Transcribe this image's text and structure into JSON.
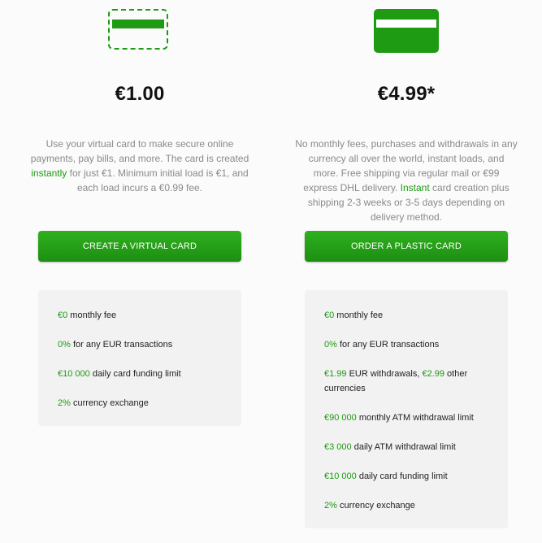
{
  "virtual": {
    "price": "€1.00",
    "desc_before": "Use your virtual card to make secure online payments, pay bills, and more. The card is created ",
    "desc_highlight": "instantly",
    "desc_after": " for just €1. Minimum initial load is €1, and each load incurs a €0.99 fee.",
    "button_label": "CREATE A VIRTUAL CARD",
    "features": [
      {
        "value": "€0",
        "text": " monthly fee"
      },
      {
        "value": "0%",
        "text": " for any EUR transactions"
      },
      {
        "value": "€10 000",
        "text": " daily card funding limit"
      },
      {
        "value": "2%",
        "text": " currency exchange"
      }
    ]
  },
  "plastic": {
    "price": "€4.99*",
    "desc_before": "No monthly fees, purchases and withdrawals in any currency all over the world, instant loads, and more. Free shipping via regular mail or €99 express DHL delivery. ",
    "desc_highlight": "Instant",
    "desc_after": " card creation plus shipping 2-3 weeks or 3-5 days depending on delivery method.",
    "button_label": "ORDER A PLASTIC CARD",
    "features": [
      {
        "value": "€0",
        "text": " monthly fee"
      },
      {
        "value": "0%",
        "text": " for any EUR transactions"
      },
      {
        "value": "€1.99",
        "text": " EUR withdrawals, ",
        "value2": "€2.99",
        "text2": " other currencies"
      },
      {
        "value": "€90 000",
        "text": " monthly ATM withdrawal limit"
      },
      {
        "value": "€3 000",
        "text": " daily ATM withdrawal limit"
      },
      {
        "value": "€10 000",
        "text": " daily card funding limit"
      },
      {
        "value": "2%",
        "text": " currency exchange"
      }
    ]
  },
  "colors": {
    "accent": "#1e9a13",
    "muted_text": "#8a8a8a",
    "panel_bg": "#f2f2f2"
  },
  "icons": {
    "virtual": "virtual-card-icon",
    "plastic": "plastic-card-icon"
  }
}
